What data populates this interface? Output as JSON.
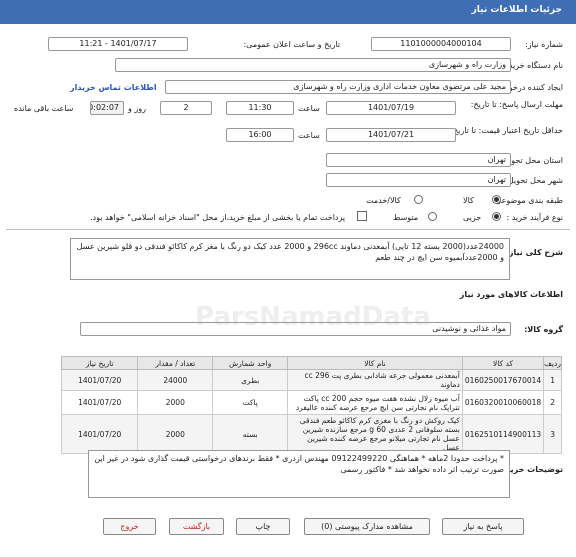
{
  "header": {
    "title": "جزئیات اطلاعات نیاز"
  },
  "form": {
    "need_number_label": "شماره نیاز:",
    "need_number": "1101000004000104",
    "announce_label": "تاریخ و ساعت اعلان عمومی:",
    "announce_value": "1401/07/17 - 11:21",
    "buyer_org_label": "نام دستگاه خریدار:",
    "buyer_org": "وزارت راه و شهرسازی",
    "creator_label": "ایجاد کننده درخواست:",
    "creator": "مجید علی مرتضوی معاون خدمات اداری وزارت راه و شهرسازی",
    "contact_link": "اطلاعات تماس خریدار",
    "deadline_label": "مهلت ارسال پاسخ: تا تاریخ:",
    "deadline_date": "1401/07/19",
    "time_label": "ساعت",
    "deadline_time": "11:30",
    "days_value": "2",
    "days_label": "روز و",
    "remaining_value": "00:02:07",
    "remaining_label": "ساعت باقی مانده",
    "validity_label": "حداقل تاریخ اعتبار قیمت: تا تاریخ:",
    "validity_date": "1401/07/21",
    "validity_time_label": "ساعت",
    "validity_time": "16:00",
    "province_label": "استان محل تحویل:",
    "province": "تهران",
    "city_label": "شهر محل تحویل:",
    "city": "تهران",
    "category_label": "طبقه بندی موضوعی:",
    "category_goods": "کالا",
    "category_goods_service": "کالا/خدمت",
    "process_label": "نوع فرآیند خرید :",
    "process_small": "جزیی",
    "process_medium": "متوسط",
    "payment_note": "پرداخت تمام یا بخشی از مبلغ خرید،از محل \"اسناد خزانه اسلامی\" خواهد بود."
  },
  "need_description": {
    "label": "شرح کلی نیاز:",
    "text": "24000عدد(2000 بسته 12 تایی) آبمعدنی دماوند 296cc و 2000 عدد کیک دو رنگ با مغز کرم کاکائو فندقی دو قلو شیرین عسل و 2000عددآبمیوه سن ایچ در چند طعم"
  },
  "goods_info": {
    "title": "اطلاعات کالاهای مورد نیاز",
    "group_label": "گروه کالا:",
    "group_value": "مواد غذائی و نوشیدنی"
  },
  "table": {
    "headers": [
      "ردیف",
      "کد کالا",
      "نام کالا",
      "واحد شمارش",
      "تعداد / مقدار",
      "تاریخ نیاز"
    ],
    "rows": [
      [
        "1",
        "0160250017670014",
        "آبمعدنی معمولی جرعه شادابی بطری پت 296 cc دماوند",
        "بطری",
        "24000",
        "1401/07/20"
      ],
      [
        "2",
        "0160320010060018",
        "آب میوه زلال نشده هفت میوه حجم 200 cc پاکت تتراپک نام تجارتی سن ایچ مرجع عرضه کننده عالیفرد",
        "پاکت",
        "2000",
        "1401/07/20"
      ],
      [
        "3",
        "0162510114900113",
        "کیک روکش دو رنگ با مغزی کرم کاکائو طعم فندقی بسته سلوفانی 2 عددی 60 g مرجع سازنده شیرین عسل نام تجارتی میلانو مرجع عرضه کننده شیرین عسل",
        "بسته",
        "2000",
        "1401/07/20"
      ]
    ]
  },
  "buyer_notes": {
    "label": "توضیحات خریدار:",
    "text": "* پرداخت حدودا 2ماهه * هماهنگی 09122499220 مهندس ازدری * فقط برندهای درخواستی قیمت گذاری شود در غیر این صورت ترتیب اثر داده نخواهد شد * فاکتور رسمی"
  },
  "buttons": {
    "reply": "پاسخ به نیاز",
    "view_docs": "مشاهده مدارک پیوستی (0)",
    "print": "چاپ",
    "back": "بازگشت",
    "exit": "خروج"
  },
  "watermark": {
    "brand": "ParsNamadData"
  }
}
